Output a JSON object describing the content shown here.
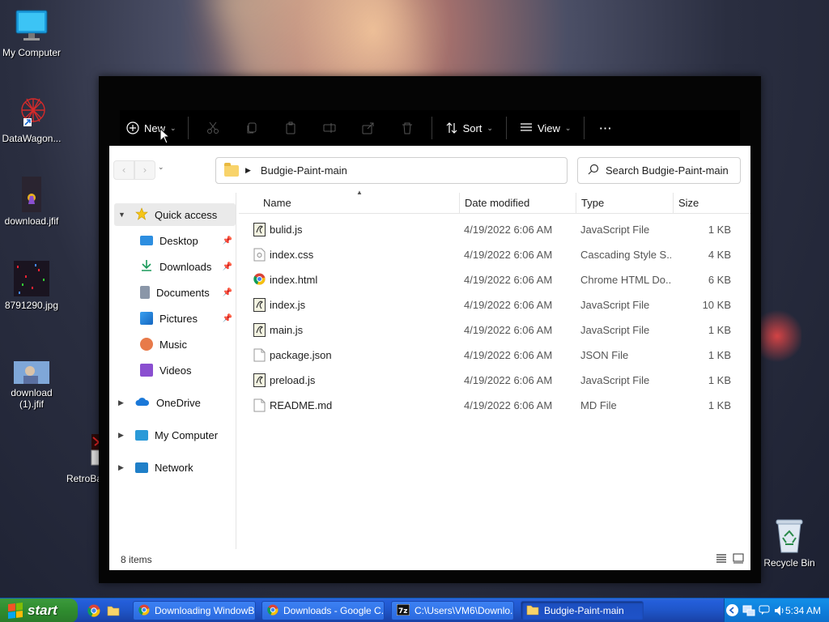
{
  "desktop": {
    "icons": [
      {
        "label": "My Computer"
      },
      {
        "label": "DataWagon..."
      },
      {
        "label": "download.jfif"
      },
      {
        "label": "8791290.jpg"
      },
      {
        "label": "download\n(1).jfif"
      },
      {
        "label": "RetroBa"
      },
      {
        "label": "Recycle Bin"
      }
    ]
  },
  "commandbar": {
    "new_label": "New",
    "sort_label": "Sort",
    "view_label": "View",
    "more_label": "···"
  },
  "address": {
    "path": "Budgie-Paint-main",
    "search_placeholder": "Search Budgie-Paint-main"
  },
  "navpane": {
    "items": [
      {
        "label": "Quick access"
      },
      {
        "label": "Desktop"
      },
      {
        "label": "Downloads"
      },
      {
        "label": "Documents"
      },
      {
        "label": "Pictures"
      },
      {
        "label": "Music"
      },
      {
        "label": "Videos"
      },
      {
        "label": "OneDrive"
      },
      {
        "label": "My Computer"
      },
      {
        "label": "Network"
      }
    ]
  },
  "filelist": {
    "columns": [
      "Name",
      "Date modified",
      "Type",
      "Size"
    ],
    "rows": [
      {
        "name": "bulid.js",
        "date": "4/19/2022 6:06 AM",
        "type": "JavaScript File",
        "size": "1 KB",
        "icon": "js-file-icon"
      },
      {
        "name": "index.css",
        "date": "4/19/2022 6:06 AM",
        "type": "Cascading Style S...",
        "size": "4 KB",
        "icon": "css-file-icon"
      },
      {
        "name": "index.html",
        "date": "4/19/2022 6:06 AM",
        "type": "Chrome HTML Do...",
        "size": "6 KB",
        "icon": "chrome-html-icon"
      },
      {
        "name": "index.js",
        "date": "4/19/2022 6:06 AM",
        "type": "JavaScript File",
        "size": "10 KB",
        "icon": "js-file-icon"
      },
      {
        "name": "main.js",
        "date": "4/19/2022 6:06 AM",
        "type": "JavaScript File",
        "size": "1 KB",
        "icon": "js-file-icon"
      },
      {
        "name": "package.json",
        "date": "4/19/2022 6:06 AM",
        "type": "JSON File",
        "size": "1 KB",
        "icon": "blank-file-icon"
      },
      {
        "name": "preload.js",
        "date": "4/19/2022 6:06 AM",
        "type": "JavaScript File",
        "size": "1 KB",
        "icon": "js-file-icon"
      },
      {
        "name": "README.md",
        "date": "4/19/2022 6:06 AM",
        "type": "MD File",
        "size": "1 KB",
        "icon": "blank-file-icon"
      }
    ]
  },
  "status": {
    "item_count": "8 items"
  },
  "taskbar": {
    "start_label": "start",
    "tasks": [
      {
        "label": "Downloading WindowBl..."
      },
      {
        "label": "Downloads - Google C..."
      },
      {
        "label": "C:\\Users\\VM6\\Downlo..."
      },
      {
        "label": "Budgie-Paint-main"
      }
    ],
    "clock": "5:34 AM"
  },
  "colors": {
    "accent": "#0078d4",
    "taskbar": "#245edb",
    "start": "#2f8c2f"
  }
}
